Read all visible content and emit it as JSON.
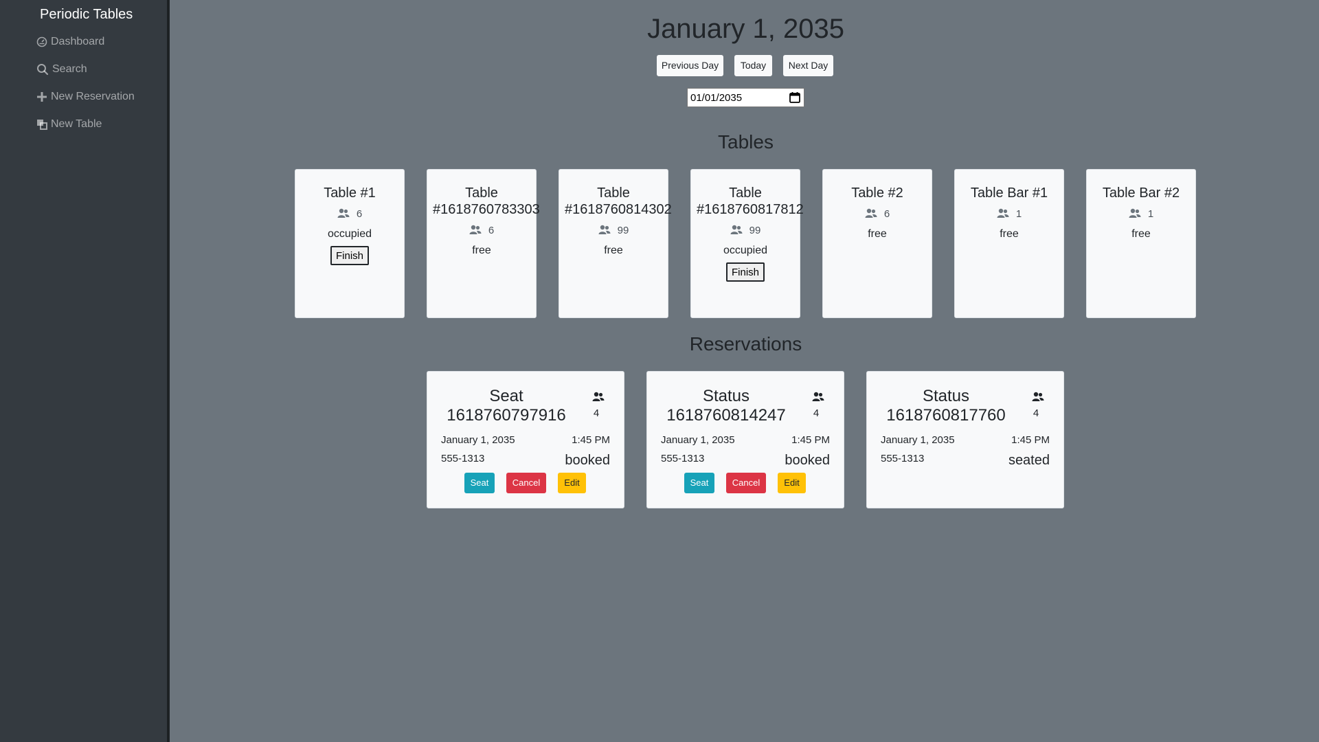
{
  "app": {
    "brand": "Periodic Tables"
  },
  "sidebar": {
    "items": [
      {
        "label": "Dashboard",
        "icon": "dashboard-icon"
      },
      {
        "label": "Search",
        "icon": "search-icon"
      },
      {
        "label": "New Reservation",
        "icon": "plus-icon"
      },
      {
        "label": "New Table",
        "icon": "table-icon"
      }
    ]
  },
  "dashboard": {
    "date_heading": "January 1, 2035",
    "prev_label": "Previous Day",
    "today_label": "Today",
    "next_label": "Next Day",
    "date_value": "01/01/2035"
  },
  "tables_section": {
    "title": "Tables",
    "tables": [
      {
        "name": "Table #1",
        "capacity": "6",
        "status": "occupied",
        "finish_label": "Finish"
      },
      {
        "name": "Table #1618760783303",
        "capacity": "6",
        "status": "free"
      },
      {
        "name": "Table #1618760814302",
        "capacity": "99",
        "status": "free"
      },
      {
        "name": "Table #1618760817812",
        "capacity": "99",
        "status": "occupied",
        "finish_label": "Finish"
      },
      {
        "name": "Table #2",
        "capacity": "6",
        "status": "free"
      },
      {
        "name": "Table Bar #1",
        "capacity": "1",
        "status": "free"
      },
      {
        "name": "Table Bar #2",
        "capacity": "1",
        "status": "free"
      }
    ]
  },
  "reservations_section": {
    "title": "Reservations",
    "reservations": [
      {
        "label": "Seat 1618760797916",
        "people": "4",
        "date": "January 1, 2035",
        "time": "1:45 PM",
        "phone": "555-1313",
        "status": "booked",
        "seat_label": "Seat",
        "cancel_label": "Cancel",
        "edit_label": "Edit"
      },
      {
        "label": "Status 1618760814247",
        "people": "4",
        "date": "January 1, 2035",
        "time": "1:45 PM",
        "phone": "555-1313",
        "status": "booked",
        "seat_label": "Seat",
        "cancel_label": "Cancel",
        "edit_label": "Edit"
      },
      {
        "label": "Status 1618760817760",
        "people": "4",
        "date": "January 1, 2035",
        "time": "1:45 PM",
        "phone": "555-1313",
        "status": "seated"
      }
    ]
  },
  "colors": {
    "sidebar_bg": "#343a40",
    "main_bg": "#6c757d",
    "card_bg": "#f8f9fa",
    "seat": "#17a2b8",
    "cancel": "#dc3545",
    "edit": "#ffc107"
  }
}
